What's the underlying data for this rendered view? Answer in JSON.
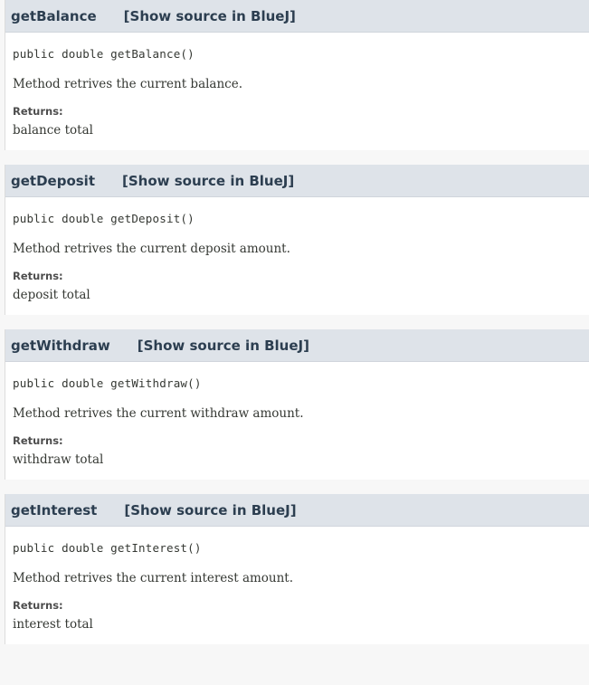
{
  "methods": [
    {
      "name": "getBalance",
      "source_link": "[Show source in BlueJ]",
      "signature": "public double getBalance()",
      "description": "Method retrives the current balance.",
      "returns_label": "Returns:",
      "returns_value": "balance total"
    },
    {
      "name": "getDeposit",
      "source_link": "[Show source in BlueJ]",
      "signature": "public double getDeposit()",
      "description": "Method retrives the current deposit amount.",
      "returns_label": "Returns:",
      "returns_value": "deposit total"
    },
    {
      "name": "getWithdraw",
      "source_link": "[Show source in BlueJ]",
      "signature": "public double getWithdraw()",
      "description": "Method retrives the current withdraw amount.",
      "returns_label": "Returns:",
      "returns_value": "withdraw total"
    },
    {
      "name": "getInterest",
      "source_link": "[Show source in BlueJ]",
      "signature": "public double getInterest()",
      "description": "Method retrives the current interest amount.",
      "returns_label": "Returns:",
      "returns_value": "interest total"
    }
  ]
}
